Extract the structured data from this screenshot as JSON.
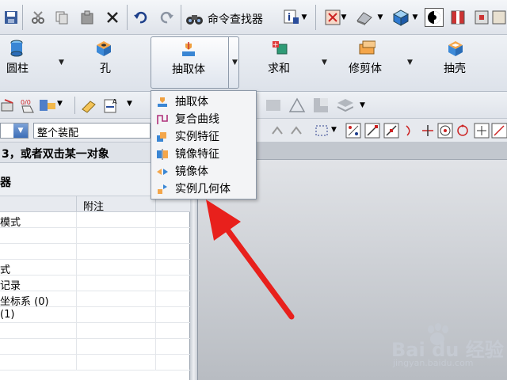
{
  "toolbar": {
    "command_finder_label": "命令查找器"
  },
  "ribbon": {
    "groups": [
      {
        "label": "圆柱"
      },
      {
        "label": "孔"
      },
      {
        "label": "抽取体"
      },
      {
        "label": "求和"
      },
      {
        "label": "修剪体"
      },
      {
        "label": "抽壳"
      }
    ]
  },
  "dropdown_menu": {
    "items": [
      {
        "label": "抽取体",
        "icon": "extract-body-icon"
      },
      {
        "label": "复合曲线",
        "icon": "composite-curve-icon"
      },
      {
        "label": "实例特征",
        "icon": "instance-feature-icon"
      },
      {
        "label": "镜像特征",
        "icon": "mirror-feature-icon"
      },
      {
        "label": "镜像体",
        "icon": "mirror-body-icon"
      },
      {
        "label": "实例几何体",
        "icon": "instance-geometry-icon"
      }
    ]
  },
  "selection_bar": {
    "filter_value": "整个装配"
  },
  "navigator": {
    "prompt": "3，或者双击某一对象",
    "title": "器",
    "column_notes": "附注",
    "rows": [
      {
        "text": "模式"
      },
      {
        "text": ""
      },
      {
        "text": ""
      },
      {
        "text": "式"
      },
      {
        "text": "记录"
      },
      {
        "text": " 坐标系 (0)"
      },
      {
        "text": "  (1)"
      },
      {
        "text": ""
      },
      {
        "text": ""
      },
      {
        "text": ""
      }
    ]
  },
  "watermark": {
    "brand": "Bai du 经验",
    "url": "jingyan.baidu.com"
  },
  "colors": {
    "accent_arrow": "#e8201c",
    "menu_bg": "#f3f4f6",
    "ribbon_bg": "#e4e8ee"
  }
}
